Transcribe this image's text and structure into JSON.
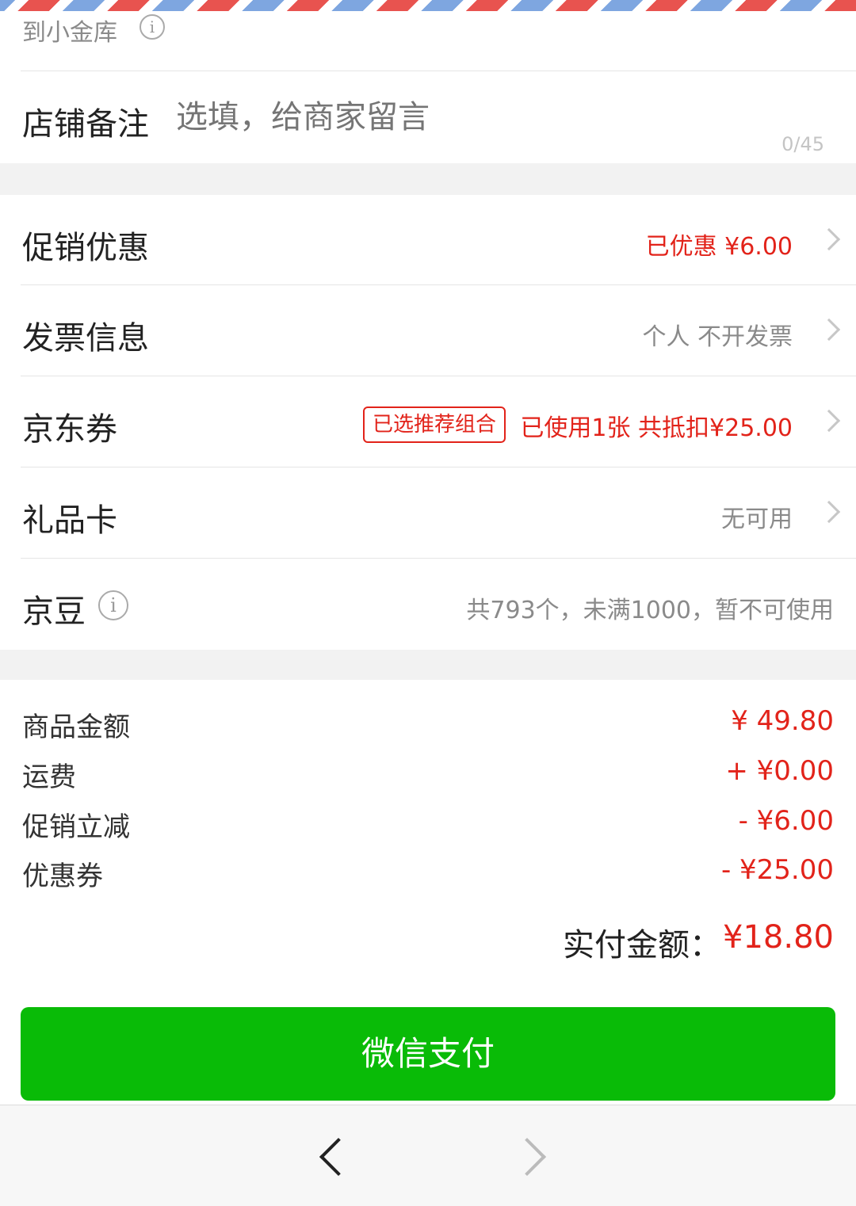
{
  "top": {
    "partial_label": "到小金库",
    "info_icon": "info-icon"
  },
  "shop_note": {
    "label": "店铺备注",
    "placeholder": "选填，给商家留言",
    "value": "",
    "counter": "0/45"
  },
  "options": {
    "promotion": {
      "label": "促销优惠",
      "value": "已优惠 ¥6.00"
    },
    "invoice": {
      "label": "发票信息",
      "value": "个人 不开发票"
    },
    "coupon": {
      "label": "京东券",
      "badge": "已选推荐组合",
      "value": "已使用1张 共抵扣¥25.00"
    },
    "gift_card": {
      "label": "礼品卡",
      "value": "无可用"
    },
    "jd_beans": {
      "label": "京豆",
      "value": "共793个，未满1000，暂不可使用"
    }
  },
  "summary": {
    "goods_amount": {
      "label": "商品金额",
      "value": "¥ 49.80"
    },
    "shipping": {
      "label": "运费",
      "value": "+ ¥0.00"
    },
    "promo_discount": {
      "label": "促销立减",
      "value": "- ¥6.00"
    },
    "coupon_discount": {
      "label": "优惠券",
      "value": "- ¥25.00"
    },
    "total_label": "实付金额：",
    "total_value": "¥18.80"
  },
  "pay_button": {
    "label": "微信支付"
  },
  "toolbar": {
    "back_icon": "chevron-left-icon",
    "forward_icon": "chevron-right-icon"
  },
  "colors": {
    "accent_red": "#e2231a",
    "wechat_green": "#09bb07"
  }
}
